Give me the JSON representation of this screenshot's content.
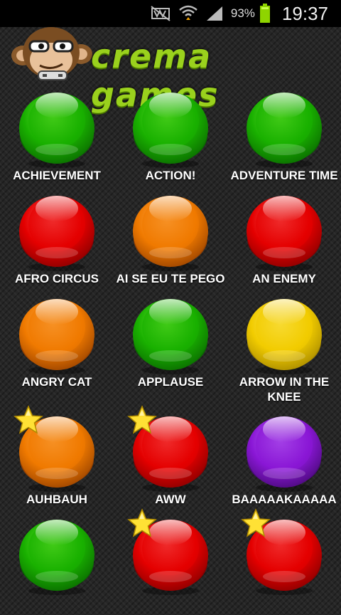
{
  "status_bar": {
    "battery_percent": "93%",
    "time": "19:37",
    "icons": [
      "mute-icon",
      "wifi-icon",
      "signal-icon",
      "battery-icon"
    ]
  },
  "header": {
    "brand": "crema games",
    "logo": "monkey-mascot"
  },
  "colors": {
    "green": [
      "#7bf03a",
      "#19b000",
      "#0a6b00"
    ],
    "red": [
      "#ff6a6a",
      "#e40000",
      "#8a0000"
    ],
    "orange": [
      "#ffb25a",
      "#f07a00",
      "#9a4300"
    ],
    "yellow": [
      "#fff07a",
      "#f2cc00",
      "#a88a00"
    ],
    "purple": [
      "#c77bff",
      "#8a17d6",
      "#4a0a7a"
    ],
    "star": "#ffe135"
  },
  "sounds": [
    {
      "label": "ACHIEVEMENT",
      "color": "green",
      "favorite": false
    },
    {
      "label": "ACTION!",
      "color": "green",
      "favorite": false
    },
    {
      "label": "ADVENTURE TIME",
      "color": "green",
      "favorite": false
    },
    {
      "label": "AFRO CIRCUS",
      "color": "red",
      "favorite": false
    },
    {
      "label": "AI SE EU TE PEGO",
      "color": "orange",
      "favorite": false
    },
    {
      "label": "AN ENEMY",
      "color": "red",
      "favorite": false
    },
    {
      "label": "ANGRY CAT",
      "color": "orange",
      "favorite": false
    },
    {
      "label": "APPLAUSE",
      "color": "green",
      "favorite": false
    },
    {
      "label": "ARROW IN THE KNEE",
      "color": "yellow",
      "favorite": false
    },
    {
      "label": "AUHBAUH",
      "color": "orange",
      "favorite": true
    },
    {
      "label": "AWW",
      "color": "red",
      "favorite": true
    },
    {
      "label": "BAAAAAKAAAAA",
      "color": "purple",
      "favorite": false
    },
    {
      "label": "",
      "color": "green",
      "favorite": false
    },
    {
      "label": "",
      "color": "red",
      "favorite": true
    },
    {
      "label": "",
      "color": "red",
      "favorite": true
    }
  ]
}
